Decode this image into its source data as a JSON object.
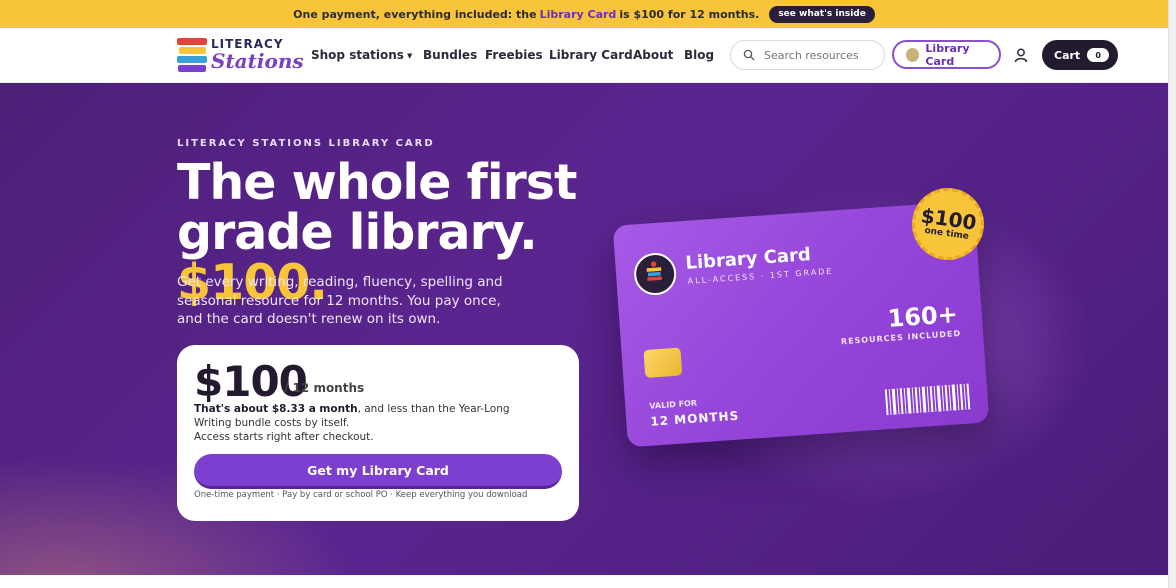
{
  "announcement": {
    "part1": "One payment, everything included: the",
    "highlight": "Library Card",
    "part2": "is $100 for 12 months.",
    "pill": "see what's inside"
  },
  "header": {
    "logo_top": "LITERACY",
    "logo_bottom": "Stations",
    "nav": [
      {
        "label": "Shop stations",
        "has_caret": true
      },
      {
        "label": "Bundles"
      },
      {
        "label": "Freebies"
      },
      {
        "label": "Library Card"
      },
      {
        "label": "About"
      },
      {
        "label": "Blog"
      }
    ],
    "search_placeholder": "Search resources",
    "library_button": "Library Card",
    "cart_label": "Cart",
    "cart_count": "0"
  },
  "hero": {
    "eyebrow": "LITERACY STATIONS LIBRARY CARD",
    "headline_l1": "The whole first",
    "headline_l2": "grade library.",
    "headline_accent": "$100.",
    "subtext": "Get every writing, reading, fluency, spelling and seasonal resource for 12 months. You pay once, and the card doesn't renew on its own.",
    "price": {
      "amount": "$100",
      "period": "/ 12 months",
      "about_bold": "That's about $8.33 a month",
      "about_rest": ", and less than the Year-Long",
      "line2": "Writing bundle costs by itself.",
      "line3": "Access starts right after checkout.",
      "cta": "Get my Library Card",
      "fineprint": "One-time payment · Pay by card or school PO · Keep everything you download"
    }
  },
  "card": {
    "title": "Library Card",
    "subtitle": "ALL-ACCESS · 1ST GRADE",
    "count": "160+",
    "count_label": "RESOURCES INCLUDED",
    "valid_label": "VALID FOR",
    "valid_value": "12 MONTHS",
    "stamp_value": "$100",
    "stamp_label": "one time"
  },
  "colors": {
    "brand_purple": "#7d3fd0",
    "accent_yellow": "#f8c53a",
    "dark": "#231a30"
  }
}
